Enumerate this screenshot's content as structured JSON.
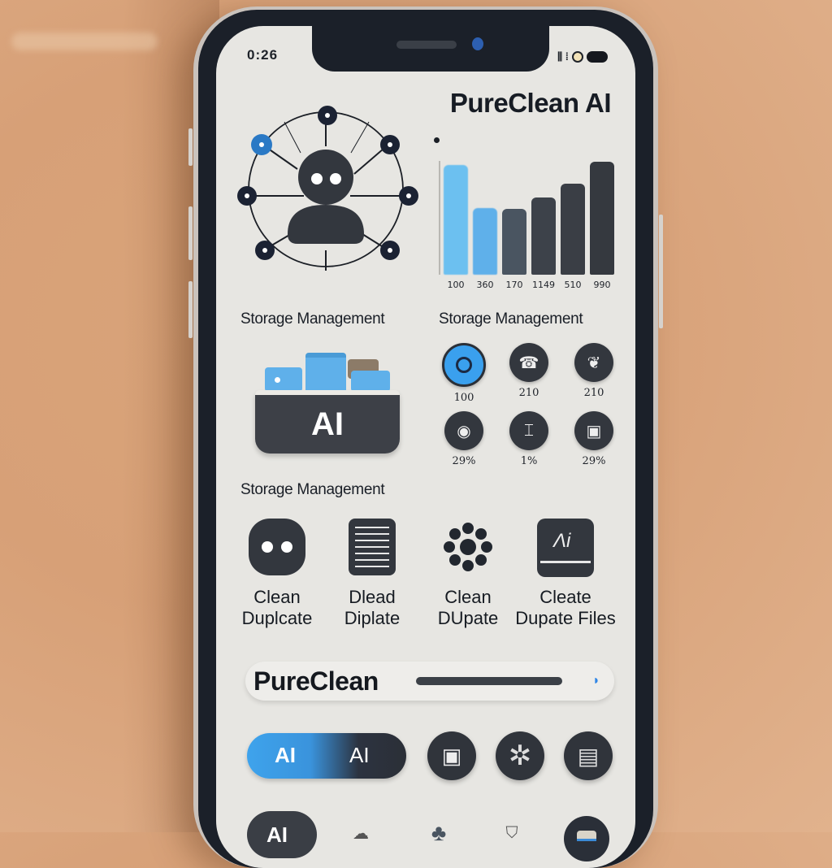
{
  "status_bar": {
    "time": "0:26",
    "signal_icon": "signal-icon",
    "wifi_icon": "wifi-icon",
    "battery_icon": "battery-icon"
  },
  "header": {
    "app_title": "PureClean AI"
  },
  "hero": {
    "illustration": "ai-network-avatar-icon"
  },
  "chart_data": {
    "type": "bar",
    "title": "",
    "xlabel": "",
    "ylabel": "",
    "categories": [
      "100",
      "360",
      "170",
      "1149",
      "510",
      "990"
    ],
    "values": [
      95,
      58,
      57,
      67,
      79,
      98
    ],
    "ylim": [
      0,
      100
    ],
    "colors": [
      "#6cc0f0",
      "#5fb0ea",
      "#4a5561",
      "#3d424a",
      "#3a3e45",
      "#35393f"
    ],
    "grid": false
  },
  "sections": {
    "storage_label_left": "Storage Management",
    "storage_label_right": "Storage Management",
    "storage_label_mid": "Storage Management"
  },
  "storage_card": {
    "badge_text": "AI",
    "icon": "storage-boxes-icon"
  },
  "stats": [
    {
      "icon": "target-icon",
      "value": "100",
      "active": true
    },
    {
      "icon": "phone-icon",
      "value": "210",
      "active": false
    },
    {
      "icon": "leaf-icon",
      "value": "210",
      "active": false
    },
    {
      "icon": "disc-icon",
      "value": "29%",
      "active": false
    },
    {
      "icon": "tools-icon",
      "value": "1%",
      "active": false
    },
    {
      "icon": "square-icon",
      "value": "29%",
      "active": false
    }
  ],
  "actions": [
    {
      "icon": "bot-face-icon",
      "line1": "Clean",
      "line2": "Duplcate"
    },
    {
      "icon": "list-icon",
      "line1": "Dlead",
      "line2": "Diplate"
    },
    {
      "icon": "flower-icon",
      "line1": "Clean",
      "line2": "DUpate"
    },
    {
      "icon": "ai-card-icon",
      "line1": "Cleate",
      "line2": "Dupate Files"
    }
  ],
  "progress": {
    "title": "PureClean",
    "percent": 92,
    "knob_icon": "moon-icon",
    "knob_glyph": "◗"
  },
  "controls": {
    "toggle_left": "AI",
    "toggle_right": "AI",
    "buttons": [
      {
        "icon": "square-frame-icon",
        "glyph": "▣"
      },
      {
        "icon": "fan-icon",
        "glyph": "✲"
      },
      {
        "icon": "drive-icon",
        "glyph": "▤"
      }
    ]
  },
  "tabbar": {
    "active_label": "AI",
    "tabs": [
      {
        "icon": "cloud-icon",
        "glyph": "☁"
      },
      {
        "icon": "brain-icon",
        "glyph": "♣"
      },
      {
        "icon": "shield-icon",
        "glyph": "⛉"
      },
      {
        "icon": "book-icon",
        "glyph": "▭"
      }
    ]
  },
  "colors": {
    "accent": "#3ea3ec",
    "dark": "#30343b",
    "screen": "#e7e6e2",
    "background": "#d9a47a"
  }
}
